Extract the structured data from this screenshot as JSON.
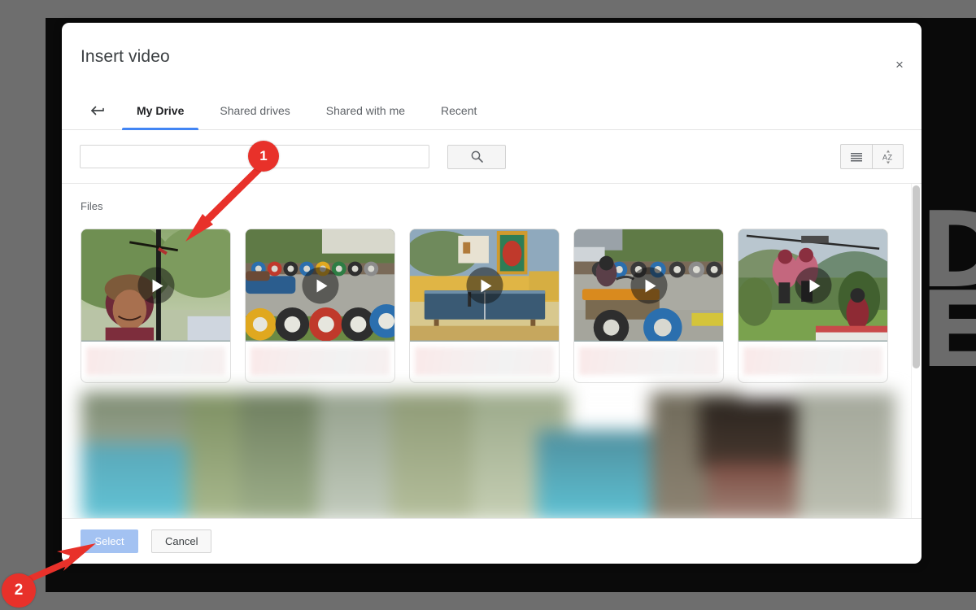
{
  "window": {
    "backdrop_color": "#0a0a0a",
    "outer_bg_color": "#6e6e6e",
    "ghost_text": "DI\nE"
  },
  "dialog": {
    "title": "Insert video",
    "close_label": "×",
    "back_icon": "back-arrow-icon",
    "tabs": [
      {
        "label": "My Drive",
        "active": true
      },
      {
        "label": "Shared drives",
        "active": false
      },
      {
        "label": "Shared with me",
        "active": false
      },
      {
        "label": "Recent",
        "active": false
      }
    ],
    "active_tab_color": "#4285f4"
  },
  "toolbar": {
    "search_value": "",
    "search_placeholder": "",
    "search_button_icon": "search-icon",
    "view_list_icon": "list-view-icon",
    "sort_az_icon": "sort-alpha-icon"
  },
  "content": {
    "section_label": "Files",
    "files": [
      {
        "name_redacted": true,
        "thumbnail": "zipline-rider-helmet-green-hills",
        "media_type": "video",
        "play_icon": "play-icon"
      },
      {
        "name_redacted": true,
        "thumbnail": "go-kart-track-colored-tyres",
        "media_type": "video",
        "play_icon": "play-icon"
      },
      {
        "name_redacted": true,
        "thumbnail": "table-tennis-court-yellow-wall",
        "media_type": "video",
        "play_icon": "play-icon"
      },
      {
        "name_redacted": true,
        "thumbnail": "go-kart-driver-orange-kart",
        "media_type": "video",
        "play_icon": "play-icon"
      },
      {
        "name_redacted": true,
        "thumbnail": "zipline-two-riders-valley",
        "media_type": "video",
        "play_icon": "play-icon"
      }
    ],
    "second_row_blurred": true,
    "scrollbar": {
      "visible": true
    }
  },
  "footer": {
    "select_label": "Select",
    "select_disabled": true,
    "select_color": "#a3c2f2",
    "cancel_label": "Cancel"
  },
  "annotations": {
    "marker_color": "#e8312a",
    "markers": [
      {
        "number": "1",
        "points_at": "first-file-card"
      },
      {
        "number": "2",
        "points_at": "select-button"
      }
    ]
  }
}
